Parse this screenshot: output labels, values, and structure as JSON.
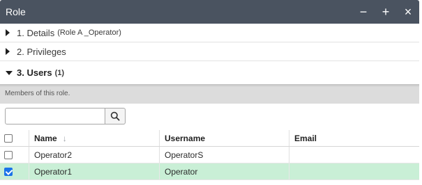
{
  "window": {
    "title": "Role",
    "controls": {
      "minimize": "−",
      "maximize": "+",
      "close": "×"
    }
  },
  "sections": [
    {
      "label": "1. Details",
      "detail": "(Role A _Operator)",
      "expanded": false
    },
    {
      "label": "2. Privileges",
      "detail": "",
      "expanded": false
    },
    {
      "label": "3. Users",
      "detail": "(1)",
      "expanded": true
    }
  ],
  "users_panel": {
    "description": "Members of this role.",
    "search": {
      "value": "",
      "placeholder": ""
    },
    "columns": {
      "name": "Name",
      "username": "Username",
      "email": "Email"
    },
    "sort_indicator": "↓",
    "rows": [
      {
        "name": "Operator2",
        "username": "OperatorS",
        "email": "",
        "checked": false
      },
      {
        "name": "Operator1",
        "username": "Operator",
        "email": "",
        "checked": true
      }
    ]
  },
  "colors": {
    "titlebar": "#4a5360",
    "selected_row": "#c9efd6",
    "checkbox_checked": "#1a73e8"
  }
}
